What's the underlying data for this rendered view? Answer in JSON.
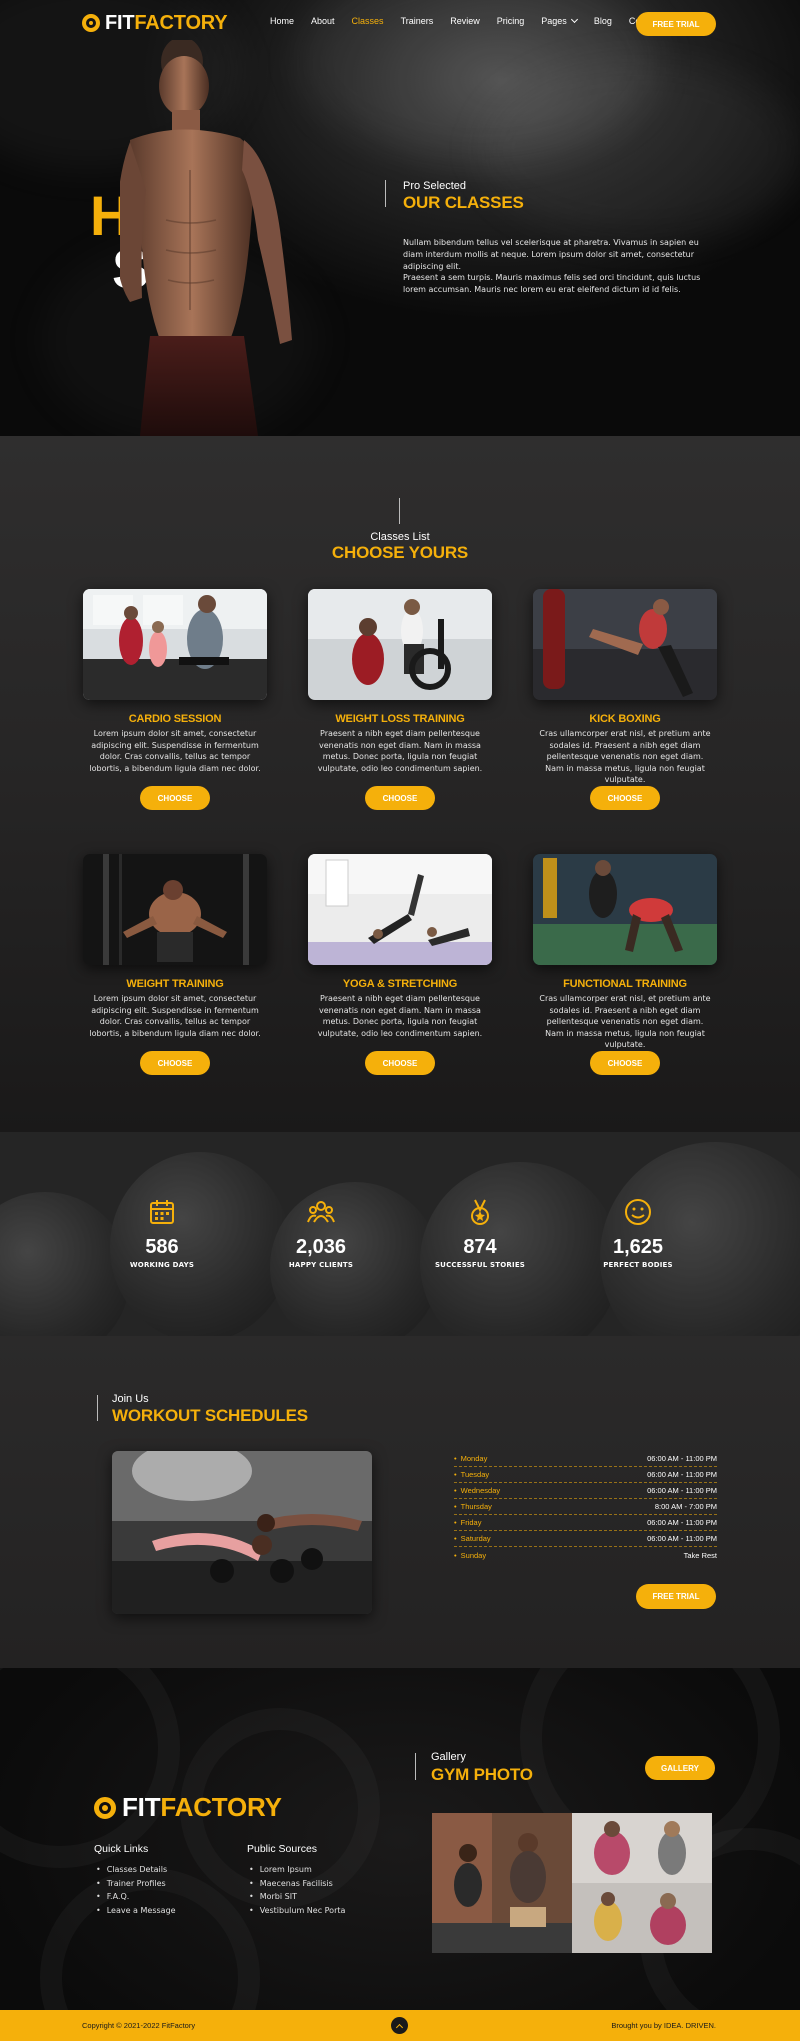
{
  "brand": {
    "fit": "FIT",
    "factory": "FACTORY"
  },
  "colors": {
    "accent": "#f5b00b",
    "dark": "#0c0b0b",
    "panel": "#2a2929"
  },
  "nav": {
    "items": [
      {
        "label": "Home"
      },
      {
        "label": "About"
      },
      {
        "label": "Classes",
        "active": true
      },
      {
        "label": "Trainers"
      },
      {
        "label": "Review"
      },
      {
        "label": "Pricing"
      },
      {
        "label": "Pages",
        "has_dropdown": true
      },
      {
        "label": "Blog"
      },
      {
        "label": "Contact"
      }
    ],
    "cta": "FREE TRIAL"
  },
  "hero": {
    "big_line1": "H    CK",
    "big_line2": "S        S",
    "kicker": "Pro Selected",
    "title": "OUR CLASSES",
    "p1": "Nullam bibendum tellus vel scelerisque at pharetra. Vivamus in sapien eu diam interdum mollis at neque. Lorem ipsum dolor sit amet, consectetur adipiscing elit.",
    "p2": "Praesent a sem turpis. Mauris maximus felis sed orci tincidunt, quis luctus lorem accumsan. Mauris nec lorem eu erat eleifend dictum id id felis."
  },
  "classes": {
    "kicker": "Classes List",
    "title": "CHOOSE YOURS",
    "button_label": "CHOOSE",
    "items": [
      {
        "title": "CARDIO SESSION",
        "desc": "Lorem ipsum dolor sit amet, consectetur adipiscing elit. Suspendisse in fermentum dolor. Cras convallis, tellus ac tempor lobortis, a bibendum ligula diam nec dolor.",
        "image": "treadmill-photo"
      },
      {
        "title": "WEIGHT LOSS TRAINING",
        "desc": "Praesent a nibh eget diam pellentesque venenatis non eget diam. Nam in massa metus. Donec porta, ligula non feugiat vulputate, odio leo condimentum sapien.",
        "image": "elliptical-photo"
      },
      {
        "title": "KICK BOXING",
        "desc": "Cras ullamcorper erat nisl, et pretium ante sodales id. Praesent a nibh eget diam pellentesque venenatis non eget diam. Nam in massa metus, ligula non feugiat vulputate.",
        "image": "kickboxing-photo"
      },
      {
        "title": "WEIGHT TRAINING",
        "desc": "Lorem ipsum dolor sit amet, consectetur adipiscing elit. Suspendisse in fermentum dolor. Cras convallis, tellus ac tempor lobortis, a bibendum ligula diam nec dolor.",
        "image": "cable-machine-photo"
      },
      {
        "title": "YOGA & STRETCHING",
        "desc": "Praesent a nibh eget diam pellentesque venenatis non eget diam. Nam in massa metus. Donec porta, ligula non feugiat vulputate, odio leo condimentum sapien.",
        "image": "yoga-photo"
      },
      {
        "title": "FUNCTIONAL TRAINING",
        "desc": "Cras ullamcorper erat nisl, et pretium ante sodales id. Praesent a nibh eget diam pellentesque venenatis non eget diam. Nam in massa metus, ligula non feugiat vulputate.",
        "image": "functional-photo"
      }
    ]
  },
  "stats": [
    {
      "icon": "calendar-icon",
      "number": "586",
      "label": "WORKING DAYS"
    },
    {
      "icon": "group-icon",
      "number": "2,036",
      "label": "HAPPY CLIENTS"
    },
    {
      "icon": "medal-icon",
      "number": "874",
      "label": "SUCCESSFUL STORIES"
    },
    {
      "icon": "smile-face-icon",
      "number": "1,625",
      "label": "PERFECT BODIES"
    }
  ],
  "schedule": {
    "kicker": "Join Us",
    "title": "WORKOUT SCHEDULES",
    "rows": [
      {
        "day": "Monday",
        "time": "06:00 AM - 11:00 PM"
      },
      {
        "day": "Tuesday",
        "time": "06:00 AM - 11:00 PM"
      },
      {
        "day": "Wednesday",
        "time": "06:00 AM - 11:00 PM"
      },
      {
        "day": "Thursday",
        "time": "8:00 AM - 7:00 PM"
      },
      {
        "day": "Friday",
        "time": "06:00 AM - 11:00 PM"
      },
      {
        "day": "Saturday",
        "time": "06:00 AM - 11:00 PM"
      },
      {
        "day": "Sunday",
        "time": "Take Rest"
      }
    ],
    "cta": "FREE TRIAL"
  },
  "footer": {
    "quick_links": {
      "title": "Quick Links",
      "items": [
        "Classes Details",
        "Trainer Profiles",
        "F.A.Q.",
        "Leave a Message"
      ]
    },
    "public_sources": {
      "title": "Public Sources",
      "items": [
        "Lorem Ipsum",
        "Maecenas Facilisis",
        "Morbi SIT",
        "Vestibulum Nec Porta"
      ]
    },
    "gallery": {
      "kicker": "Gallery",
      "title": "GYM PHOTO",
      "button": "GALLERY"
    },
    "copyright": "Copyright © 2021-2022 FitFactory",
    "credit": "Brought you by IDEA. DRIVEN."
  }
}
